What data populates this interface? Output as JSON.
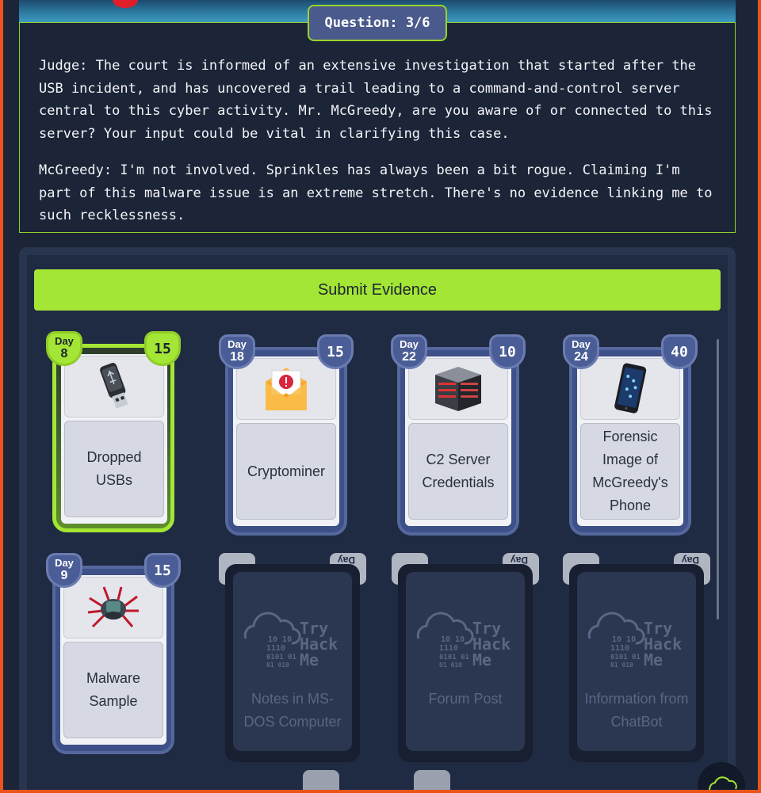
{
  "question": {
    "label": "Question: 3/6"
  },
  "dialog": {
    "judge": "Judge: The court is informed of an extensive investigation that started after the USB incident, and has uncovered a trail leading to a command-and-control server central to this cyber activity. Mr. McGreedy, are you aware of or connected to this server? Your input could be vital in clarifying this case.",
    "mcgreedy": "McGreedy: I'm not involved. Sprinkles has always been a bit rogue. Claiming I'm part of this malware issue is an extreme stretch. There's no evidence linking me to such recklessness."
  },
  "submit": {
    "label": "Submit Evidence"
  },
  "cards": [
    {
      "day_label": "Day",
      "day": "8",
      "points": "15",
      "title": "Dropped USBs",
      "icon": "usb-drive-icon",
      "active": true
    },
    {
      "day_label": "Day",
      "day": "18",
      "points": "15",
      "title": "Cryptominer",
      "icon": "email-alert-icon",
      "active": false
    },
    {
      "day_label": "Day",
      "day": "22",
      "points": "10",
      "title": "C2 Server Credentials",
      "icon": "server-icon",
      "active": false
    },
    {
      "day_label": "Day",
      "day": "24",
      "points": "40",
      "title": "Forensic Image of McGreedy's Phone",
      "icon": "phone-icon",
      "active": false
    },
    {
      "day_label": "Day",
      "day": "9",
      "points": "15",
      "title": "Malware Sample",
      "icon": "malware-bug-icon",
      "active": false
    }
  ],
  "locked_cards": [
    {
      "title": "Notes in MS-DOS Computer",
      "tab": "Day"
    },
    {
      "title": "Forum Post",
      "tab": "Day"
    },
    {
      "title": "Information from ChatBot",
      "tab": "Day"
    }
  ],
  "logo": {
    "line1": "Try",
    "line2": "Hack",
    "line3": "Me",
    "binary": "10 10|1110|0101 01|01 010"
  },
  "colors": {
    "accent": "#a3e635",
    "card": "#3e5088",
    "background": "#1c2537",
    "border": "#e8541c"
  }
}
